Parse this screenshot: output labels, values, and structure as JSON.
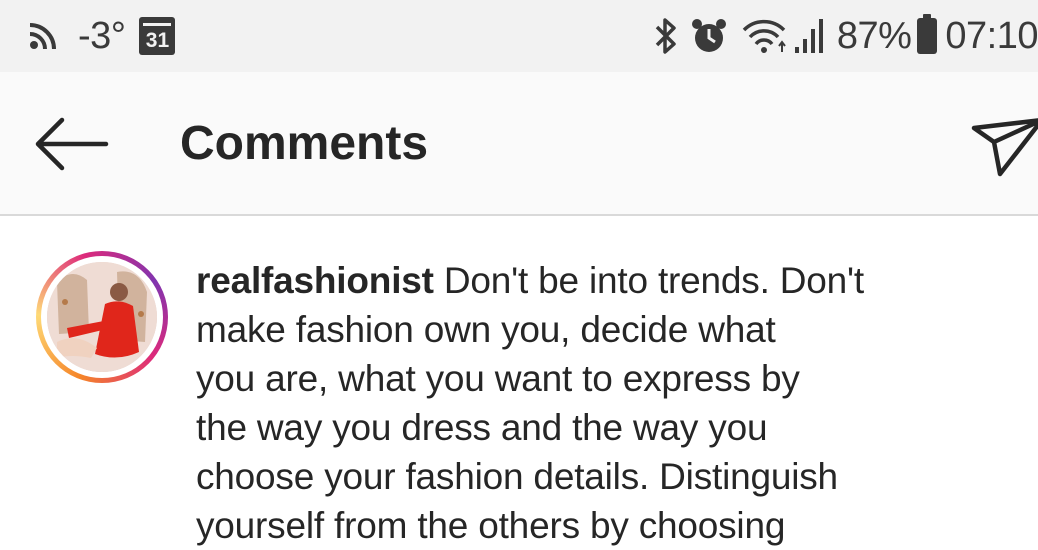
{
  "status_bar": {
    "temperature": "-3°",
    "calendar_day": "31",
    "battery_percent": "87%",
    "time": "07:10",
    "icons": [
      "cast-icon",
      "calendar-icon",
      "bluetooth-icon",
      "alarm-icon",
      "wifi-icon",
      "signal-icon",
      "battery-icon"
    ]
  },
  "header": {
    "title": "Comments",
    "back_icon": "arrow-left-icon",
    "direct_icon": "paper-plane-icon"
  },
  "comment": {
    "username": "realfashionist",
    "lines": [
      "Don't be into trends. Don't",
      "make fashion own you, decide what",
      "you are, what you want to express by",
      "the way you dress and the way you",
      "choose your fashion details. Distinguish",
      "yourself from the others by choosing"
    ]
  },
  "colors": {
    "status_bg": "#f2f2f2",
    "header_bg": "#fafafa",
    "text": "#262626",
    "avatar_ring": [
      "#f58529",
      "#dd2a7b",
      "#8134af"
    ]
  }
}
